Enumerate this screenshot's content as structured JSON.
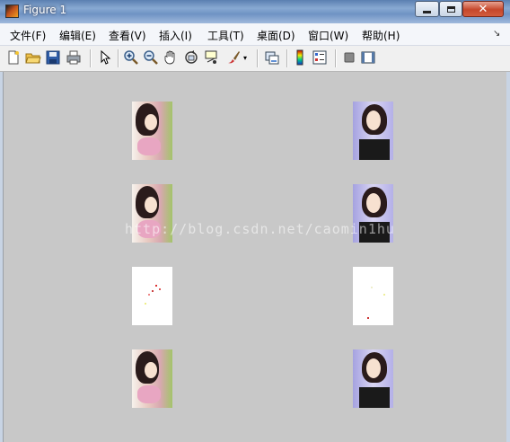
{
  "window": {
    "title": "Figure 1"
  },
  "menu": [
    "文件(F)",
    "编辑(E)",
    "查看(V)",
    "插入(I)",
    "工具(T)",
    "桌面(D)",
    "窗口(W)",
    "帮助(H)"
  ],
  "toolbar": {
    "buttons": [
      "new-figure-icon",
      "open-file-icon",
      "save-icon",
      "print-icon",
      "edit-plot-arrow-icon",
      "zoom-in-icon",
      "zoom-out-icon",
      "pan-hand-icon",
      "rotate-3d-icon",
      "data-cursor-icon",
      "brush-icon",
      "link-plot-icon",
      "colorbar-icon",
      "legend-icon",
      "hide-plot-tools-icon",
      "show-plot-tools-icon"
    ]
  },
  "figure": {
    "watermark": "http://blog.csdn.net/caomin1hu",
    "grid": {
      "rows": 4,
      "cols": 2
    }
  }
}
